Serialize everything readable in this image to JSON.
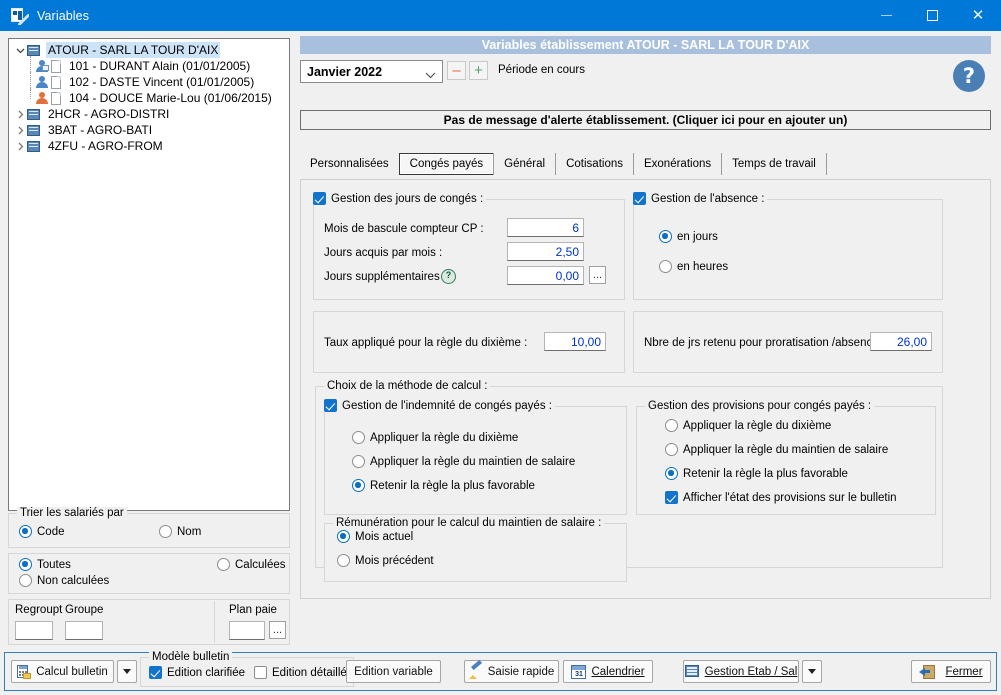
{
  "window": {
    "title": "Variables",
    "icon": "variables-app-icon",
    "controls": {
      "minimize": "—",
      "maximize": "□",
      "close": "✕"
    }
  },
  "sidebar": {
    "tree": [
      {
        "label": "ATOUR - SARL LA TOUR D'AIX",
        "type": "establishment",
        "expanded": true,
        "selected": true
      },
      {
        "label": "101 - DURANT Alain (01/01/2005)",
        "type": "employee-card",
        "color": "blue"
      },
      {
        "label": "102 - DASTE Vincent (01/01/2005)",
        "type": "employee",
        "color": "blue"
      },
      {
        "label": "104 - DOUCE Marie-Lou (01/06/2015)",
        "type": "employee",
        "color": "orange"
      },
      {
        "label": "2HCR - AGRO-DISTRI",
        "type": "establishment",
        "expanded": false
      },
      {
        "label": "3BAT - AGRO-BATI",
        "type": "establishment",
        "expanded": false
      },
      {
        "label": "4ZFU - AGRO-FROM",
        "type": "establishment",
        "expanded": false
      }
    ],
    "sort": {
      "title": "Trier les salariés par",
      "options": [
        {
          "label": "Code",
          "selected": true
        },
        {
          "label": "Nom",
          "selected": false
        }
      ]
    },
    "filter": {
      "options": [
        {
          "label": "Toutes",
          "selected": true
        },
        {
          "label": "Calculées",
          "selected": false
        },
        {
          "label": "Non calculées",
          "selected": false
        }
      ]
    },
    "regroup": {
      "regroupt_label": "Regroupt",
      "regroupt_value": "",
      "groupe_label": "Groupe",
      "groupe_value": "",
      "plan_paie_label": "Plan paie",
      "plan_paie_value": "",
      "plan_paie_browse": "..."
    }
  },
  "header": {
    "banner": "Variables établissement ATOUR - SARL LA TOUR D'AIX",
    "period_value": "Janvier 2022",
    "period_minus": "–",
    "period_plus": "+",
    "period_label": "Période en cours",
    "help": "?",
    "alert": "Pas de message d'alerte établissement. (Cliquer ici pour en ajouter un)"
  },
  "tabs": [
    {
      "label": "Personnalisées",
      "active": false
    },
    {
      "label": "Congés payés",
      "active": true
    },
    {
      "label": "Général",
      "active": false
    },
    {
      "label": "Cotisations",
      "active": false
    },
    {
      "label": "Exonérations",
      "active": false
    },
    {
      "label": "Temps de travail",
      "active": false
    }
  ],
  "main": {
    "leave_days": {
      "title": "Gestion des jours de congés :",
      "checked": true,
      "fields": [
        {
          "label": "Mois de bascule compteur CP :",
          "value": "6"
        },
        {
          "label": "Jours acquis par mois :",
          "value": "2,50"
        },
        {
          "label": "Jours supplémentaires :",
          "value": "0,00",
          "help": "?",
          "browse": "..."
        }
      ]
    },
    "tenth_rate": {
      "label": "Taux appliqué pour la règle du dixième :",
      "value": "10,00"
    },
    "absence": {
      "title": "Gestion de l'absence :",
      "checked": true,
      "options": [
        {
          "label": "en jours",
          "selected": true
        },
        {
          "label": "en heures",
          "selected": false
        }
      ]
    },
    "proration": {
      "label": "Nbre de jrs retenu pour proratisation /absence :",
      "value": "26,00"
    },
    "method": {
      "title": "Choix de la méthode de calcul :",
      "indemnity": {
        "title": "Gestion de l'indemnité de congés payés :",
        "checked": true,
        "options": [
          {
            "label": "Appliquer la règle du dixième",
            "selected": false
          },
          {
            "label": "Appliquer la règle du maintien de salaire",
            "selected": false
          },
          {
            "label": "Retenir la règle la plus favorable",
            "selected": true
          }
        ]
      },
      "remuneration": {
        "title": "Rémunération pour le calcul du maintien de salaire :",
        "options": [
          {
            "label": "Mois actuel",
            "selected": true
          },
          {
            "label": "Mois précédent",
            "selected": false
          }
        ]
      },
      "provisions": {
        "title": "Gestion des provisions pour congés payés :",
        "options": [
          {
            "label": "Appliquer la règle du dixième",
            "selected": false
          },
          {
            "label": "Appliquer la règle du maintien de salaire",
            "selected": false
          },
          {
            "label": "Retenir la règle la plus favorable",
            "selected": true
          }
        ],
        "checkbox": {
          "label": "Afficher l'état des provisions sur le bulletin",
          "checked": true
        }
      }
    }
  },
  "toolbar": {
    "calcul_bulletin": "Calcul bulletin",
    "calcul_caret": "▾",
    "model_title": "Modèle bulletin",
    "edition_clarifiee": {
      "label": "Edition clarifiée",
      "checked": true
    },
    "edition_detaillee": {
      "label": "Edition détaillée",
      "checked": false
    },
    "edition_variable": "Edition variable",
    "saisie_rapide": "Saisie rapide",
    "calendrier": "Calendrier",
    "calendrier_day": "31",
    "gestion_etab_sal": "Gestion Etab / Sal",
    "gestion_caret": "▾",
    "fermer": "Fermer"
  },
  "colors": {
    "titlebar": "#0078d7",
    "banner": "#a8c0dd",
    "accent": "#1273cc",
    "value_text": "#0033cc",
    "selection": "#cde3f7"
  }
}
